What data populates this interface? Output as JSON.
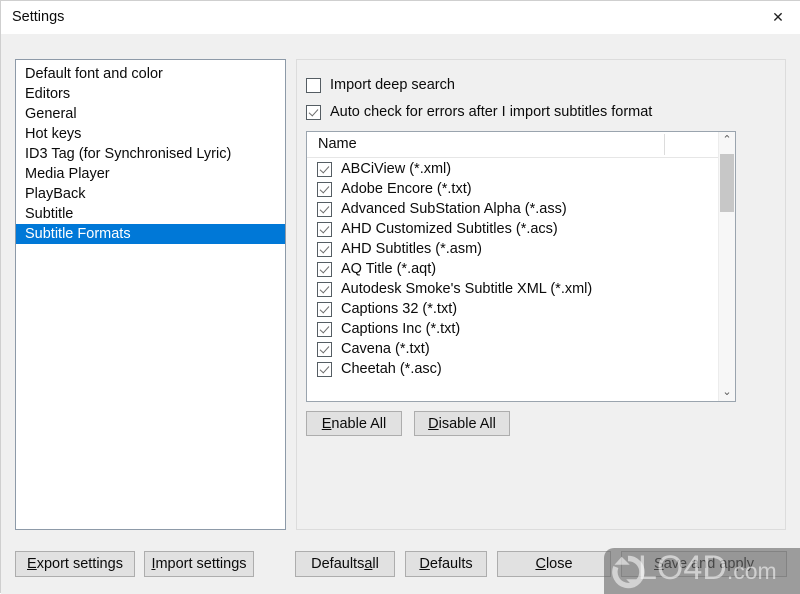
{
  "window": {
    "title": "Settings",
    "close_icon": "close-icon",
    "close_glyph": "✕"
  },
  "categories": {
    "items": [
      {
        "label": "Default font and color",
        "selected": false
      },
      {
        "label": "Editors",
        "selected": false
      },
      {
        "label": "General",
        "selected": false
      },
      {
        "label": "Hot keys",
        "selected": false
      },
      {
        "label": "ID3 Tag (for Synchronised Lyric)",
        "selected": false
      },
      {
        "label": "Media Player",
        "selected": false
      },
      {
        "label": "PlayBack",
        "selected": false
      },
      {
        "label": "Subtitle",
        "selected": false
      },
      {
        "label": "Subtitle Formats",
        "selected": true
      }
    ],
    "selection_color": "#0078d7"
  },
  "options": [
    {
      "label": "Import deep search",
      "checked": false
    },
    {
      "label": "Auto check for errors after I import subtitles format",
      "checked": true
    }
  ],
  "formats_list": {
    "column_header": "Name",
    "rows": [
      {
        "label": "ABCiView (*.xml)",
        "checked": true
      },
      {
        "label": "Adobe Encore (*.txt)",
        "checked": true
      },
      {
        "label": "Advanced SubStation Alpha (*.ass)",
        "checked": true
      },
      {
        "label": "AHD Customized Subtitles (*.acs)",
        "checked": true
      },
      {
        "label": "AHD Subtitles (*.asm)",
        "checked": true
      },
      {
        "label": "AQ Title (*.aqt)",
        "checked": true
      },
      {
        "label": "Autodesk Smoke's Subtitle XML (*.xml)",
        "checked": true
      },
      {
        "label": "Captions 32 (*.txt)",
        "checked": true
      },
      {
        "label": "Captions Inc (*.txt)",
        "checked": true
      },
      {
        "label": "Cavena (*.txt)",
        "checked": true
      },
      {
        "label": "Cheetah (*.asc)",
        "checked": true
      }
    ],
    "scroll_up_glyph": "⌃",
    "scroll_down_glyph": "⌄"
  },
  "list_buttons": [
    {
      "accel": "E",
      "rest": "nable All"
    },
    {
      "accel": "D",
      "rest": "isable All"
    }
  ],
  "footer_buttons": {
    "export": {
      "accel": "E",
      "rest": "xport settings"
    },
    "import": {
      "accel": "I",
      "rest": "mport settings"
    },
    "defaults_all": {
      "pre": "Defaults ",
      "accel": "a",
      "rest": "ll"
    },
    "defaults": {
      "accel": "D",
      "rest": "efaults"
    },
    "close": {
      "accel": "C",
      "rest": "lose"
    },
    "save_apply": {
      "accel": "S",
      "rest": "ave and apply"
    }
  },
  "watermark": {
    "brand": "LO4D",
    "suffix": ".com"
  }
}
